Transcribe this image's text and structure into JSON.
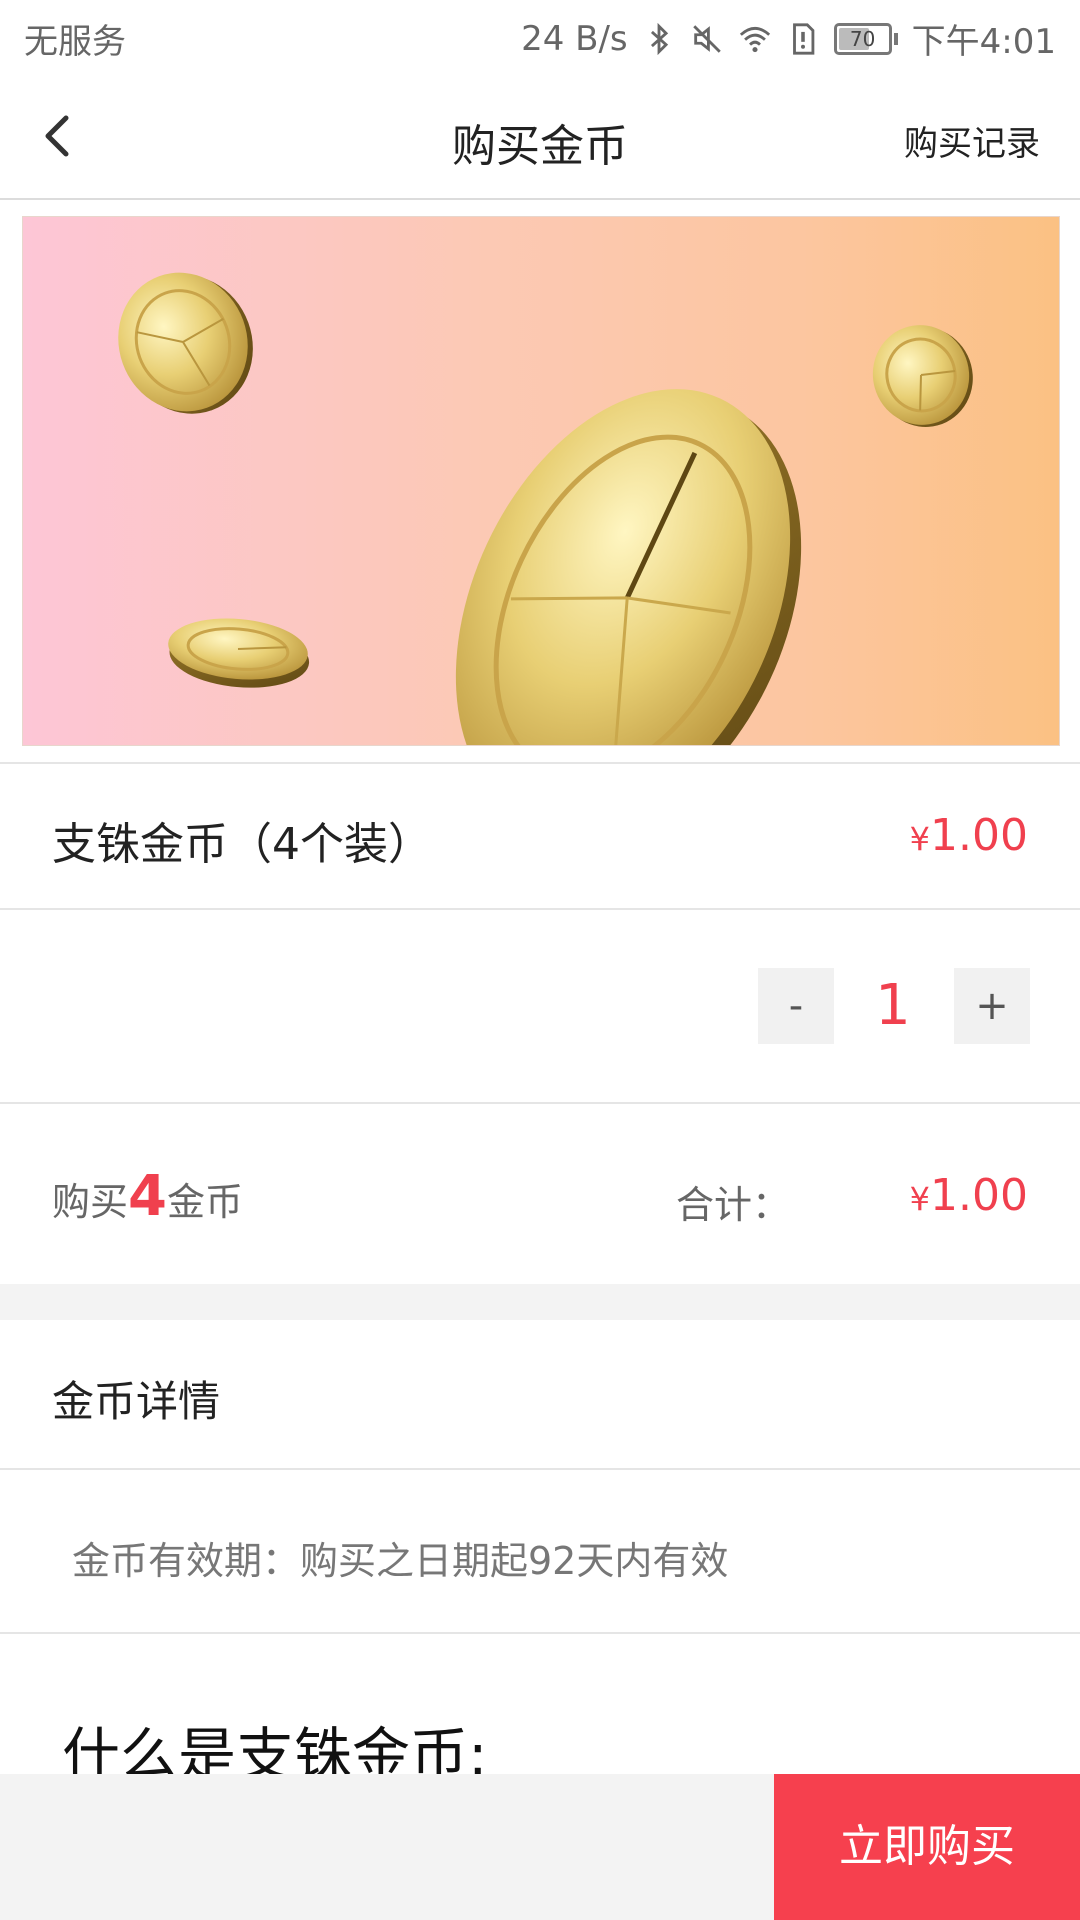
{
  "status_bar": {
    "carrier": "无服务",
    "speed": "24 B/s",
    "battery": "70",
    "battery_level": 0.7,
    "time": "下午4:01"
  },
  "nav": {
    "title": "购买金币",
    "record_link": "购买记录"
  },
  "product": {
    "name": "支铢金币（4个装）",
    "currency": "¥",
    "price": "1.00"
  },
  "stepper": {
    "minus": "-",
    "quantity": "1",
    "plus": "+"
  },
  "summary": {
    "prefix": "购买",
    "coin_count": "4",
    "suffix": "金币",
    "total_label": "合计：",
    "currency": "¥",
    "total": "1.00"
  },
  "details": {
    "title": "金币详情",
    "validity": "金币有效期：购买之日期起92天内有效",
    "what_is": "什么是支铢金币:"
  },
  "bottom": {
    "buy_button": "立即购买"
  },
  "colors": {
    "accent": "#f6404e",
    "price": "#f0404e",
    "band": "#f3f3f3"
  },
  "icons": [
    "back-arrow-icon",
    "bluetooth-icon",
    "mute-icon",
    "wifi-icon",
    "sim-alert-icon",
    "battery-icon",
    "gold-coin-icon"
  ]
}
